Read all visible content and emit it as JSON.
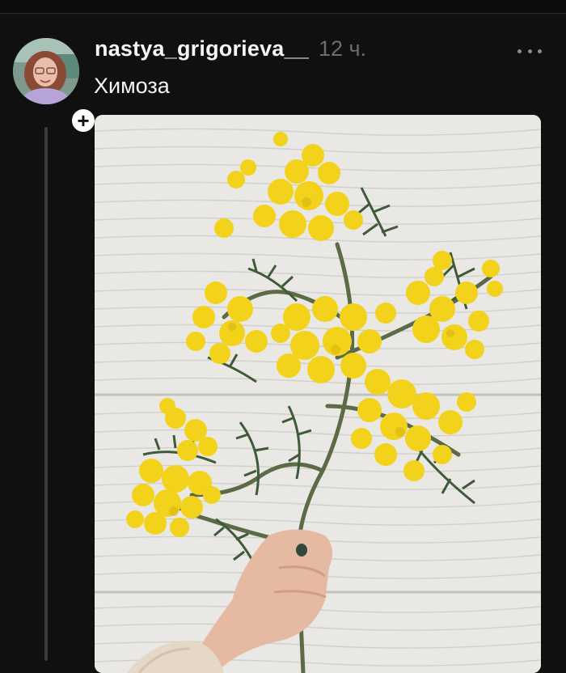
{
  "post": {
    "username": "nastya_grigorieva__",
    "timestamp": "12 ч.",
    "caption": "Химоза"
  },
  "icons": {
    "follow": "plus-icon",
    "more": "more-horizontal-icon"
  },
  "colors": {
    "background": "#101010",
    "text": "#f3f5f7",
    "muted": "#6d6d6d",
    "flower": "#f2d21a",
    "leaf": "#4f6b45",
    "wall": "#e9e8e4"
  }
}
